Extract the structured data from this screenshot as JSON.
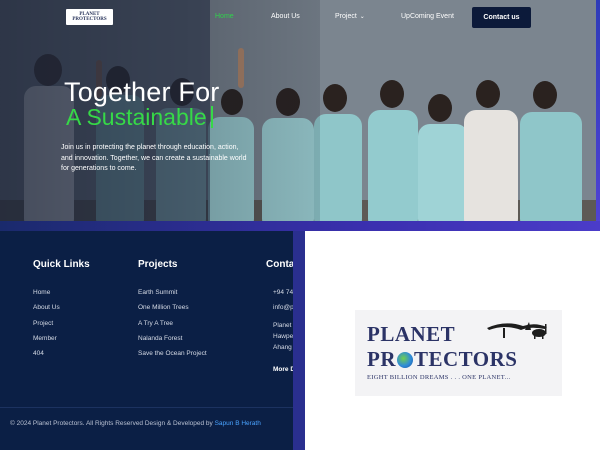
{
  "nav": {
    "logo_line1": "PLANET",
    "logo_line2": "PROTECTORS",
    "links": [
      "Home",
      "About Us",
      "Project",
      "UpComing Event"
    ],
    "contact_label": "Contact us"
  },
  "hero": {
    "title_line1": "Together For",
    "title_line2": "A Sustainable",
    "subtitle": "Join us in protecting the planet through education, action, and innovation. Together, we can create a sustainable world for generations to come."
  },
  "footer": {
    "quick_links": {
      "title": "Quick Links",
      "items": [
        "Home",
        "About Us",
        "Project",
        "Member",
        "404"
      ]
    },
    "projects": {
      "title": "Projects",
      "items": [
        "Earth Summit",
        "One Million Trees",
        "A Try A Tree",
        "Nalanda Forest",
        "Save the Ocean Project"
      ]
    },
    "contact": {
      "title": "Conta",
      "items": [
        "+94 74",
        "info@p",
        "Planet I",
        "Hawpe",
        "Ahang"
      ],
      "more": "More De"
    },
    "copyright": "© 2024 Planet Protectors. All Rights Reserved Design & Developed by ",
    "developer": "Sapun B Herath"
  },
  "brand_logo": {
    "line1": "PLANET",
    "line2a": "PR",
    "line2b": "TECTORS",
    "tagline": "EIGHT BILLION DREAMS . . . ONE PLANET..."
  },
  "colors": {
    "accent_green": "#36d947",
    "footer_bg": "#0b1f45",
    "contact_btn": "#0c1a3a",
    "dev_link": "#4aa3ff"
  }
}
